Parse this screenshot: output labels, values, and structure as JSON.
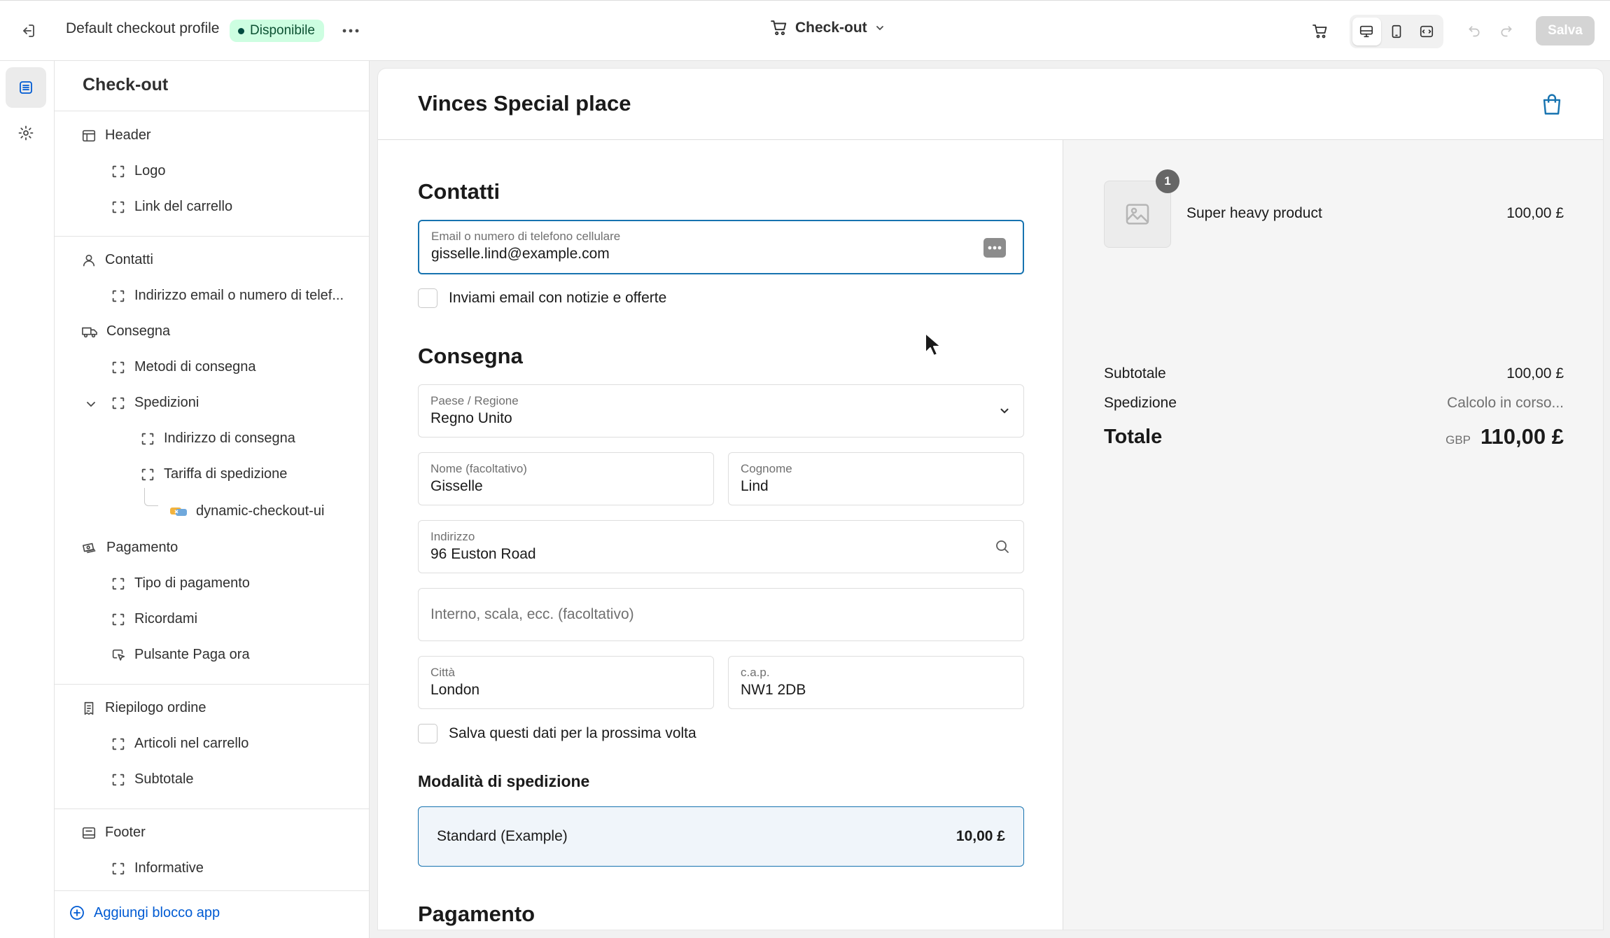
{
  "topbar": {
    "profile_name": "Default checkout profile",
    "status_badge": "Disponibile",
    "page_selector": "Check-out",
    "save_label": "Salva"
  },
  "sidebar": {
    "title": "Check-out",
    "items": [
      {
        "label": "Header",
        "icon": "header-layout-icon"
      },
      {
        "label": "Logo",
        "icon": "block-icon"
      },
      {
        "label": "Link del carrello",
        "icon": "block-icon"
      },
      {
        "label": "Contatti",
        "icon": "person-icon"
      },
      {
        "label": "Indirizzo email o numero di telef...",
        "icon": "block-icon"
      },
      {
        "label": "Consegna",
        "icon": "truck-icon"
      },
      {
        "label": "Metodi di consegna",
        "icon": "block-icon"
      },
      {
        "label": "Spedizioni",
        "icon": "block-icon"
      },
      {
        "label": "Indirizzo di consegna",
        "icon": "block-icon"
      },
      {
        "label": "Tariffa di spedizione",
        "icon": "block-icon"
      },
      {
        "label": "dynamic-checkout-ui",
        "icon": "app-icon"
      },
      {
        "label": "Pagamento",
        "icon": "cash-icon"
      },
      {
        "label": "Tipo di pagamento",
        "icon": "block-icon"
      },
      {
        "label": "Ricordami",
        "icon": "block-icon"
      },
      {
        "label": "Pulsante Paga ora",
        "icon": "cursor-block-icon"
      },
      {
        "label": "Riepilogo ordine",
        "icon": "receipt-icon"
      },
      {
        "label": "Articoli nel carrello",
        "icon": "block-icon"
      },
      {
        "label": "Subtotale",
        "icon": "block-icon"
      },
      {
        "label": "Footer",
        "icon": "footer-layout-icon"
      },
      {
        "label": "Informative",
        "icon": "block-icon"
      }
    ],
    "add_app_block": "Aggiungi blocco app"
  },
  "store": {
    "name": "Vinces Special place"
  },
  "checkout": {
    "contact_heading": "Contatti",
    "email_label": "Email o numero di telefono cellulare",
    "email_value": "gisselle.lind@example.com",
    "newsletter_label": "Inviami email con notizie e offerte",
    "delivery_heading": "Consegna",
    "country_label": "Paese / Regione",
    "country_value": "Regno Unito",
    "first_name_label": "Nome (facoltativo)",
    "first_name_value": "Gisselle",
    "last_name_label": "Cognome",
    "last_name_value": "Lind",
    "address_label": "Indirizzo",
    "address_value": "96 Euston Road",
    "apartment_placeholder": "Interno, scala, ecc. (facoltativo)",
    "city_label": "Città",
    "city_value": "London",
    "postcode_label": "c.a.p.",
    "postcode_value": "NW1 2DB",
    "save_info_label": "Salva questi dati per la prossima volta",
    "shipping_method_heading": "Modalità di spedizione",
    "shipping_option_name": "Standard (Example)",
    "shipping_option_price": "10,00 £",
    "payment_heading": "Pagamento"
  },
  "summary": {
    "product_qty": "1",
    "product_name": "Super heavy product",
    "product_price": "100,00 £",
    "subtotal_label": "Subtotale",
    "subtotal_value": "100,00 £",
    "shipping_label": "Spedizione",
    "shipping_value": "Calcolo in corso...",
    "total_label": "Totale",
    "total_currency": "GBP",
    "total_value": "110,00 £"
  },
  "colors": {
    "accent": "#1773b0",
    "badge_bg": "#cdfee1",
    "badge_text": "#0c5132",
    "link": "#005bd3"
  }
}
